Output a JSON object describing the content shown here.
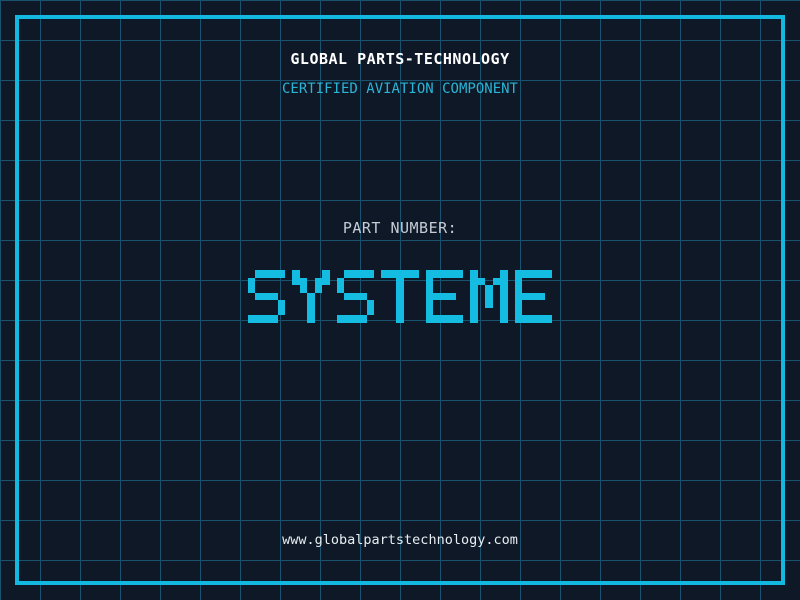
{
  "header": {
    "brand": "GLOBAL PARTS-TECHNOLOGY",
    "subtitle": "CERTIFIED AVIATION COMPONENT"
  },
  "part": {
    "label": "PART NUMBER:",
    "number": "SYSTEME"
  },
  "footer": {
    "website": "www.globalpartstechnology.com"
  },
  "colors": {
    "background": "#0e1827",
    "grid_line": "#17536e",
    "frame": "#12b8e0",
    "part_number_cyan": "#14bce2",
    "subtitle_cyan": "#2ab5d6",
    "label_gray": "#c5ccd5",
    "header_white": "#ffffff",
    "footer_white": "#e8edf1"
  }
}
